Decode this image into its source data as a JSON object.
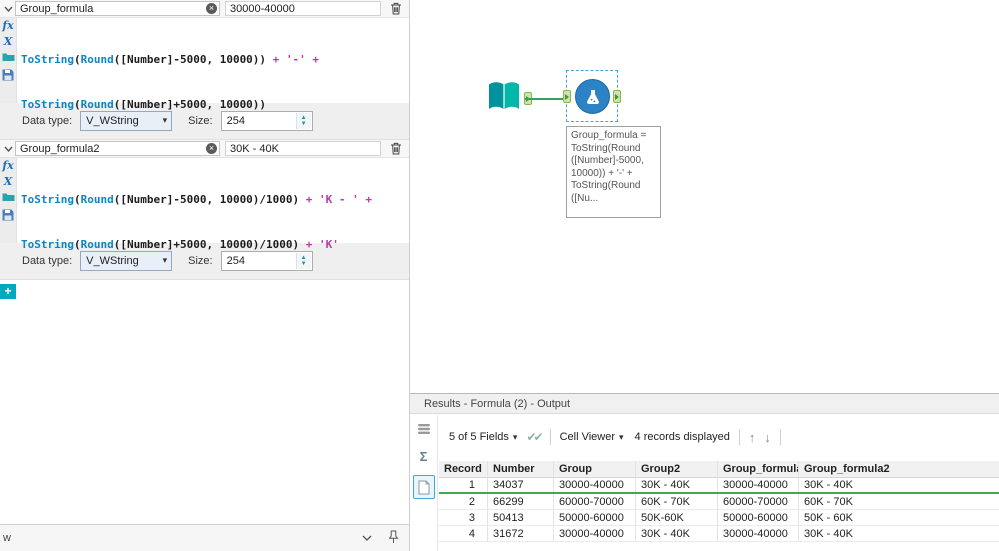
{
  "icons": {
    "fx": "fx",
    "var_x": "X",
    "dropdown_arrow": "▾",
    "spin_up": "▲",
    "spin_down": "▼",
    "add": "+",
    "clear": "×",
    "check": "✔✔",
    "arrow_up": "↑",
    "arrow_down": "↓",
    "sigma": "Σ"
  },
  "formula_panel": {
    "formulas": [
      {
        "name": "Group_formula",
        "preview": "30000-40000",
        "expression": [
          [
            {
              "text": "ToString",
              "type": "func"
            },
            {
              "text": "(",
              "type": "plain"
            },
            {
              "text": "Round",
              "type": "func"
            },
            {
              "text": "([Number]-5000, 10000))",
              "type": "plain"
            },
            {
              "text": " + ",
              "type": "op"
            },
            {
              "text": "'-'",
              "type": "str"
            },
            {
              "text": " +",
              "type": "op"
            }
          ],
          [
            {
              "text": "ToString",
              "type": "func"
            },
            {
              "text": "(",
              "type": "plain"
            },
            {
              "text": "Round",
              "type": "func"
            },
            {
              "text": "([Number]+5000, 10000))",
              "type": "plain"
            }
          ]
        ],
        "data_type_label": "Data type:",
        "data_type_value": "V_WString",
        "size_label": "Size:",
        "size_value": "254"
      },
      {
        "name": "Group_formula2",
        "preview": "30K - 40K",
        "expression": [
          [
            {
              "text": "ToString",
              "type": "func"
            },
            {
              "text": "(",
              "type": "plain"
            },
            {
              "text": "Round",
              "type": "func"
            },
            {
              "text": "([Number]-5000, 10000)/1000)",
              "type": "plain"
            },
            {
              "text": " + ",
              "type": "op"
            },
            {
              "text": "'K - '",
              "type": "str"
            },
            {
              "text": " +",
              "type": "op"
            }
          ],
          [
            {
              "text": "ToString",
              "type": "func"
            },
            {
              "text": "(",
              "type": "plain"
            },
            {
              "text": "Round",
              "type": "func"
            },
            {
              "text": "([Number]+5000, 10000)/1000)",
              "type": "plain"
            },
            {
              "text": " + ",
              "type": "op"
            },
            {
              "text": "'K'",
              "type": "str"
            }
          ]
        ],
        "data_type_label": "Data type:",
        "data_type_value": "V_WString",
        "size_label": "Size:",
        "size_value": "254"
      }
    ]
  },
  "canvas": {
    "annotation": "Group_formula =\nToString(Round\n([Number]-5000,\n10000)) + '-' +\nToString(Round\n([Nu..."
  },
  "results": {
    "title": "Results - Formula (2) - Output",
    "toolbar": {
      "fields_summary": "5 of 5 Fields",
      "cell_viewer": "Cell Viewer",
      "records_displayed": "4 records displayed"
    },
    "table": {
      "columns": [
        "Record",
        "Number",
        "Group",
        "Group2",
        "Group_formula",
        "Group_formula2"
      ],
      "rows": [
        [
          "1",
          "34037",
          "30000-40000",
          "30K - 40K",
          "30000-40000",
          "30K - 40K"
        ],
        [
          "2",
          "66299",
          "60000-70000",
          "60K - 70K",
          "60000-70000",
          "60K - 70K"
        ],
        [
          "3",
          "50413",
          "50000-60000",
          "50K-60K",
          "50000-60000",
          "50K - 60K"
        ],
        [
          "4",
          "31672",
          "30000-40000",
          "30K - 40K",
          "30000-40000",
          "30K - 40K"
        ]
      ]
    }
  },
  "bottom_bar": {
    "label": "w"
  }
}
